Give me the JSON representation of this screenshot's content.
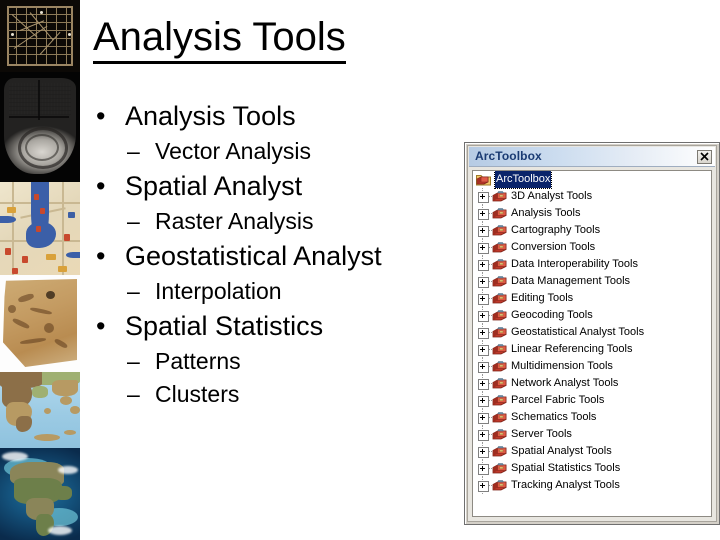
{
  "slide": {
    "title": "Analysis Tools",
    "bullets": [
      {
        "level": 1,
        "text": "Analysis Tools"
      },
      {
        "level": 2,
        "text": "Vector Analysis"
      },
      {
        "level": 1,
        "text": "Spatial Analyst"
      },
      {
        "level": 2,
        "text": "Raster Analysis"
      },
      {
        "level": 1,
        "text": "Geostatistical Analyst"
      },
      {
        "level": 2,
        "text": "Interpolation"
      },
      {
        "level": 1,
        "text": "Spatial Statistics"
      },
      {
        "level": 2,
        "text": "Patterns"
      },
      {
        "level": 2,
        "text": "Clusters"
      }
    ],
    "bullet_marker": "•",
    "subbullet_marker": "–"
  },
  "image_strip": [
    {
      "name": "marshall-islands-stick-chart"
    },
    {
      "name": "babylonian-clay-tablet-map"
    },
    {
      "name": "antique-city-map"
    },
    {
      "name": "papyrus-turin-map"
    },
    {
      "name": "greece-relief-map"
    },
    {
      "name": "north-america-satellite-map"
    }
  ],
  "arctoolbox": {
    "window_title": "ArcToolbox",
    "close_label": "×",
    "root": {
      "label": "ArcToolbox",
      "selected": true
    },
    "items": [
      {
        "label": "3D Analyst Tools"
      },
      {
        "label": "Analysis Tools"
      },
      {
        "label": "Cartography Tools"
      },
      {
        "label": "Conversion Tools"
      },
      {
        "label": "Data Interoperability Tools"
      },
      {
        "label": "Data Management Tools"
      },
      {
        "label": "Editing Tools"
      },
      {
        "label": "Geocoding Tools"
      },
      {
        "label": "Geostatistical Analyst Tools"
      },
      {
        "label": "Linear Referencing Tools"
      },
      {
        "label": "Multidimension Tools"
      },
      {
        "label": "Network Analyst Tools"
      },
      {
        "label": "Parcel Fabric Tools"
      },
      {
        "label": "Schematics Tools"
      },
      {
        "label": "Server Tools"
      },
      {
        "label": "Spatial Analyst Tools"
      },
      {
        "label": "Spatial Statistics Tools"
      },
      {
        "label": "Tracking Analyst Tools"
      }
    ],
    "expander_symbol": "+"
  },
  "colors": {
    "title_bar_text": "#1a3b73",
    "selection_blue": "#0a246a",
    "toolbox_red": "#b8352a",
    "window_chrome": "#d4d0c8"
  }
}
